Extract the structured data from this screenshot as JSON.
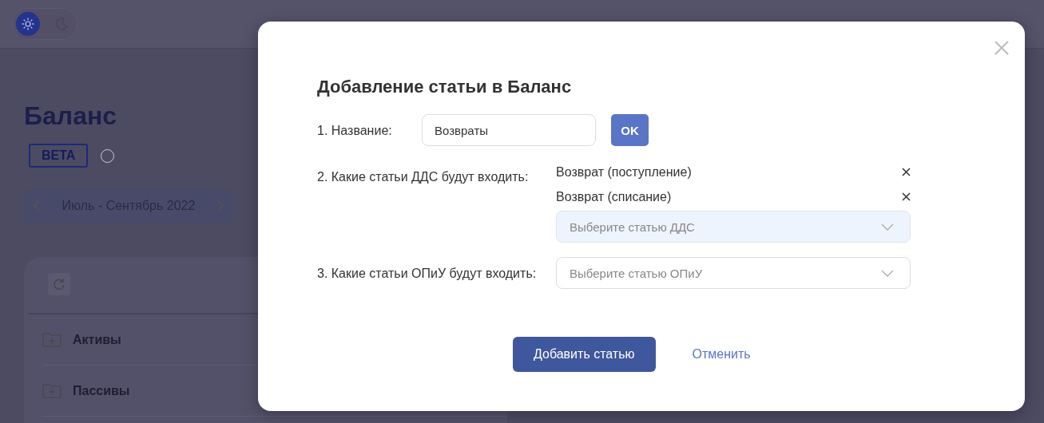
{
  "header": {
    "theme_toggle": [
      {
        "kind": "light",
        "selected": true
      },
      {
        "kind": "dark",
        "selected": false
      }
    ]
  },
  "page": {
    "title": "Баланс",
    "badge": "BETA",
    "period": "Июль - Сентябрь 2022",
    "rows": [
      {
        "label": "Активы"
      },
      {
        "label": "Пассивы"
      }
    ]
  },
  "dialog": {
    "title": "Добавление статьи в Баланс",
    "fields": [
      {
        "kind": "input",
        "label": "1. Название:",
        "value": "Возвраты",
        "button": "OK"
      },
      {
        "kind": "select",
        "label": "2. Какие статьи ДДС будут входить:",
        "items": [
          "Возврат (поступление)",
          "Возврат (списание)"
        ],
        "placeholder": "Выберите статью ДДС",
        "focused": true
      },
      {
        "kind": "select",
        "label": "3. Какие статьи ОПиУ будут входить:",
        "placeholder": "Выберите статью ОПиУ",
        "focused": false
      }
    ],
    "submit": "Добавить статью",
    "cancel": "Отменить"
  }
}
